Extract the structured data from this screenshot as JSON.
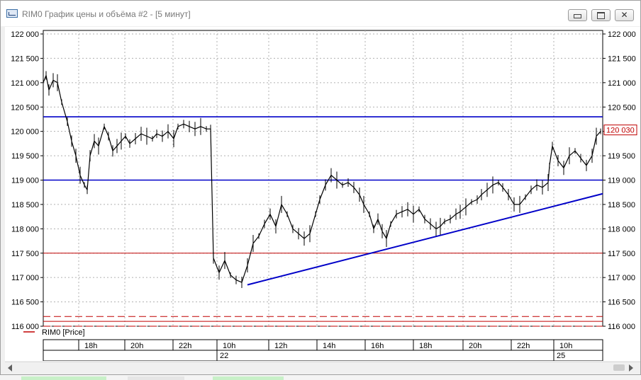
{
  "window": {
    "title": "RIM0 График цены и объёма #2 - [5 минут]",
    "controls": {
      "minimize": "minimize",
      "maximize": "maximize",
      "close": "close"
    }
  },
  "chart_data": {
    "type": "candlestick",
    "title": "",
    "instrument": "RIM0",
    "legend": [
      {
        "name": "RIM0 [Price]",
        "color": "#c00000"
      }
    ],
    "y_ticks": [
      "122 000",
      "121 500",
      "121 000",
      "120 500",
      "120 000",
      "119 500",
      "119 000",
      "118 500",
      "118 000",
      "117 500",
      "117 000",
      "116 500",
      "116 000"
    ],
    "y_tick_values": [
      122000,
      121500,
      121000,
      120500,
      120000,
      119500,
      119000,
      118500,
      118000,
      117500,
      117000,
      116500,
      116000
    ],
    "ylim": [
      116000,
      122000
    ],
    "last_price_label": "120 030",
    "last_price": 120030,
    "time_ticks": [
      "18h",
      "20h",
      "22h",
      "10h",
      "12h",
      "14h",
      "16h",
      "18h",
      "20h",
      "22h",
      "10h"
    ],
    "date_labels": [
      "22",
      "25"
    ],
    "price_points": [
      [
        0,
        121000
      ],
      [
        4,
        121150
      ],
      [
        8,
        120850
      ],
      [
        14,
        121050
      ],
      [
        20,
        121000
      ],
      [
        26,
        120600
      ],
      [
        34,
        120200
      ],
      [
        40,
        119800
      ],
      [
        46,
        119500
      ],
      [
        52,
        119100
      ],
      [
        58,
        118900
      ],
      [
        62,
        118800
      ],
      [
        66,
        119500
      ],
      [
        72,
        119800
      ],
      [
        78,
        119700
      ],
      [
        86,
        120100
      ],
      [
        92,
        119900
      ],
      [
        98,
        119600
      ],
      [
        104,
        119700
      ],
      [
        110,
        119800
      ],
      [
        116,
        119900
      ],
      [
        122,
        119750
      ],
      [
        130,
        119850
      ],
      [
        138,
        119950
      ],
      [
        146,
        119900
      ],
      [
        154,
        119850
      ],
      [
        160,
        119950
      ],
      [
        168,
        119900
      ],
      [
        176,
        120000
      ],
      [
        184,
        119850
      ],
      [
        190,
        120100
      ],
      [
        198,
        120150
      ],
      [
        206,
        120100
      ],
      [
        214,
        120050
      ],
      [
        222,
        120100
      ],
      [
        230,
        120050
      ],
      [
        236,
        120050
      ],
      [
        240,
        117400
      ],
      [
        248,
        117100
      ],
      [
        256,
        117350
      ],
      [
        264,
        117050
      ],
      [
        272,
        116950
      ],
      [
        280,
        116900
      ],
      [
        288,
        117250
      ],
      [
        296,
        117700
      ],
      [
        304,
        117850
      ],
      [
        312,
        118100
      ],
      [
        320,
        118300
      ],
      [
        328,
        118050
      ],
      [
        336,
        118500
      ],
      [
        344,
        118300
      ],
      [
        352,
        118000
      ],
      [
        360,
        117900
      ],
      [
        368,
        117800
      ],
      [
        376,
        117900
      ],
      [
        384,
        118300
      ],
      [
        390,
        118600
      ],
      [
        398,
        118900
      ],
      [
        406,
        119100
      ],
      [
        414,
        119000
      ],
      [
        422,
        118900
      ],
      [
        430,
        118950
      ],
      [
        438,
        118850
      ],
      [
        446,
        118700
      ],
      [
        452,
        118500
      ],
      [
        460,
        118300
      ],
      [
        466,
        118000
      ],
      [
        472,
        118200
      ],
      [
        478,
        117950
      ],
      [
        484,
        117800
      ],
      [
        490,
        118100
      ],
      [
        498,
        118300
      ],
      [
        506,
        118350
      ],
      [
        514,
        118400
      ],
      [
        522,
        118300
      ],
      [
        530,
        118400
      ],
      [
        538,
        118200
      ],
      [
        546,
        118100
      ],
      [
        554,
        118000
      ],
      [
        560,
        118050
      ],
      [
        566,
        118150
      ],
      [
        574,
        118200
      ],
      [
        582,
        118300
      ],
      [
        588,
        118350
      ],
      [
        596,
        118450
      ],
      [
        604,
        118550
      ],
      [
        612,
        118600
      ],
      [
        618,
        118700
      ],
      [
        626,
        118800
      ],
      [
        634,
        118900
      ],
      [
        642,
        118950
      ],
      [
        648,
        118850
      ],
      [
        656,
        118700
      ],
      [
        664,
        118500
      ],
      [
        672,
        118500
      ],
      [
        680,
        118650
      ],
      [
        688,
        118800
      ],
      [
        696,
        118900
      ],
      [
        704,
        118850
      ],
      [
        712,
        118950
      ],
      [
        714,
        119300
      ],
      [
        718,
        119700
      ],
      [
        726,
        119400
      ],
      [
        734,
        119250
      ],
      [
        742,
        119500
      ],
      [
        750,
        119600
      ],
      [
        758,
        119450
      ],
      [
        766,
        119300
      ],
      [
        774,
        119500
      ],
      [
        780,
        119900
      ],
      [
        786,
        120000
      ]
    ],
    "overlays": {
      "horizontal_lines": [
        {
          "price": 120300,
          "color": "#0000c8",
          "style": "solid"
        },
        {
          "price": 119000,
          "color": "#0000c8",
          "style": "solid"
        },
        {
          "price": 117500,
          "color": "#c00000",
          "style": "solid"
        },
        {
          "price": 116200,
          "color": "#c00000",
          "style": "dashed"
        },
        {
          "price": 116100,
          "color": "#c00000",
          "style": "solid"
        },
        {
          "price": 116000,
          "color": "#c00000",
          "style": "dashed"
        }
      ],
      "trend_line": {
        "color": "#0000c8",
        "from_price": 116850,
        "to_price": 118720
      }
    },
    "grid": true,
    "grid_style": "dotted"
  }
}
